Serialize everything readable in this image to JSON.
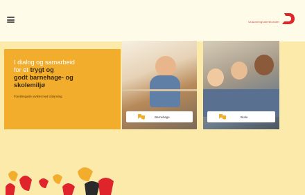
{
  "header": {
    "menu_icon": "hamburger-menu-icon",
    "brand_text": "Utdanningsdirektoratet",
    "brand_color": "#e0242b"
  },
  "hero": {
    "line1": "I dialog og samarbeid",
    "line2": "for et",
    "bold1": "trygt og",
    "bold2": "godt barnehage- og",
    "bold3": "skolemiljø",
    "subtitle": "Foreldreguide utviklet med Utdanning",
    "background_color": "#f3ad2d"
  },
  "cards": [
    {
      "label": "Barnehage"
    },
    {
      "label": "Skole"
    }
  ],
  "colors": {
    "page_bg": "#fbeaaa",
    "accent_red": "#e0242b",
    "accent_yellow": "#f3ad2d"
  }
}
